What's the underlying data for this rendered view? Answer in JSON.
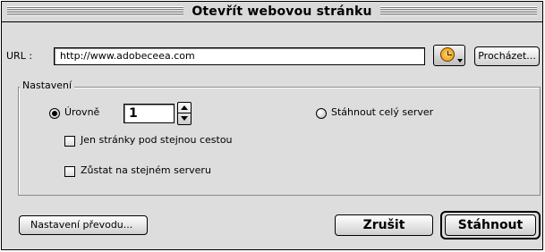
{
  "window": {
    "title": "Otevřít webovou stránku"
  },
  "url": {
    "label": "URL :",
    "value": "http://www.adobeceea.com",
    "browse_label": "Procházet..."
  },
  "settings": {
    "group_label": "Nastavení",
    "levels_label": "Úrovně",
    "levels_value": "1",
    "levels_selected": true,
    "whole_server_label": "Stáhnout celý server",
    "whole_server_selected": false,
    "same_path_label": "Jen stránky pod stejnou cestou",
    "same_path_checked": false,
    "same_server_label": "Zůstat na stejném serveru",
    "same_server_checked": false
  },
  "buttons": {
    "transfer_settings": "Nastavení převodu...",
    "cancel": "Zrušit",
    "download": "Stáhnout"
  },
  "icons": {
    "history": "clock-icon"
  }
}
